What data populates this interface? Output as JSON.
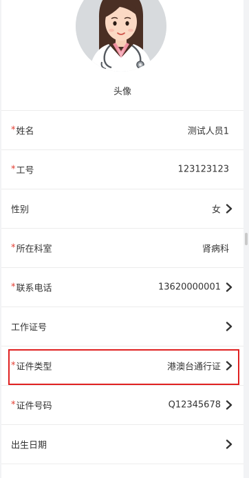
{
  "profile": {
    "avatar_label": "头像"
  },
  "fields": [
    {
      "label": "姓名",
      "required": true,
      "value": "测试人员1",
      "has_arrow": false,
      "highlighted": false
    },
    {
      "label": "工号",
      "required": true,
      "value": "123123123",
      "has_arrow": false,
      "highlighted": false
    },
    {
      "label": "性别",
      "required": false,
      "value": "女",
      "has_arrow": true,
      "highlighted": false
    },
    {
      "label": "所在科室",
      "required": true,
      "value": "肾病科",
      "has_arrow": false,
      "highlighted": false
    },
    {
      "label": "联系电话",
      "required": true,
      "value": "13620000001",
      "has_arrow": true,
      "highlighted": false
    },
    {
      "label": "工作证号",
      "required": false,
      "value": "",
      "has_arrow": true,
      "highlighted": false
    },
    {
      "label": "证件类型",
      "required": true,
      "value": "港澳台通行证",
      "has_arrow": true,
      "highlighted": true
    },
    {
      "label": "证件号码",
      "required": true,
      "value": "Q12345678",
      "has_arrow": true,
      "highlighted": false
    },
    {
      "label": "出生日期",
      "required": false,
      "value": "",
      "has_arrow": true,
      "highlighted": false
    }
  ],
  "required_mark": "*",
  "colors": {
    "required": "#e23a2e",
    "highlight_border": "#e02020",
    "chevron": "#333333"
  },
  "icons": {
    "avatar": "doctor-avatar-icon",
    "arrow": "chevron-right-icon"
  }
}
